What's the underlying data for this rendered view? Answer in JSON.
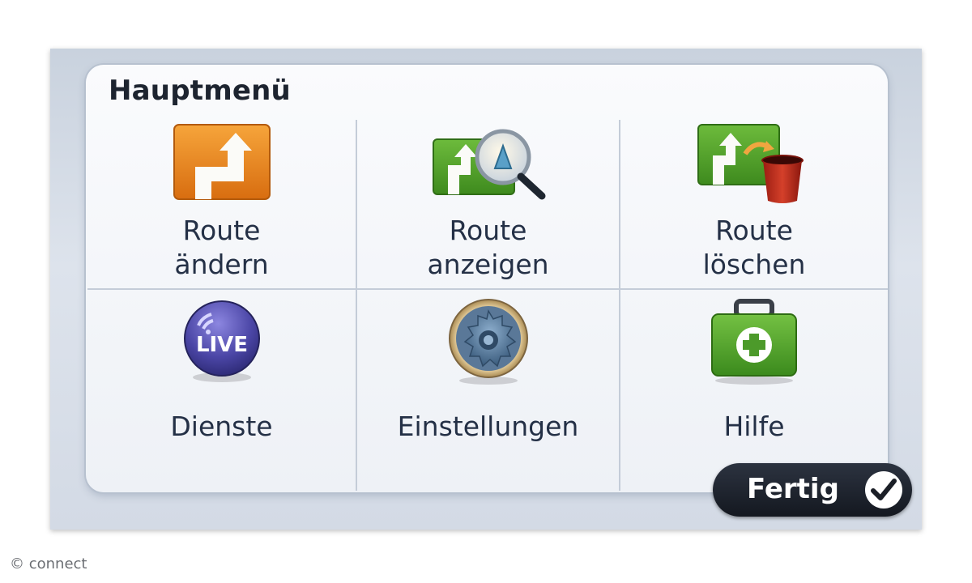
{
  "title": "Hauptmenü",
  "menu_items": [
    {
      "line1": "Route",
      "line2": "ändern",
      "icon": "route-change-icon"
    },
    {
      "line1": "Route",
      "line2": "anzeigen",
      "icon": "route-view-icon"
    },
    {
      "line1": "Route",
      "line2": "löschen",
      "icon": "route-delete-icon"
    },
    {
      "line1": "Dienste",
      "line2": "",
      "icon": "live-services-icon"
    },
    {
      "line1": "Einstellungen",
      "line2": "",
      "icon": "settings-gear-icon"
    },
    {
      "line1": "Hilfe",
      "line2": "",
      "icon": "help-first-aid-icon"
    }
  ],
  "live_badge": "LIVE",
  "done_button": {
    "label": "Fertig",
    "icon": "checkmark-icon"
  },
  "watermark": "© connect",
  "colors": {
    "orange": "#e88a1f",
    "green": "#4c9a2a",
    "live_purple": "#4d49a8",
    "button_dark": "#1b1f27"
  }
}
